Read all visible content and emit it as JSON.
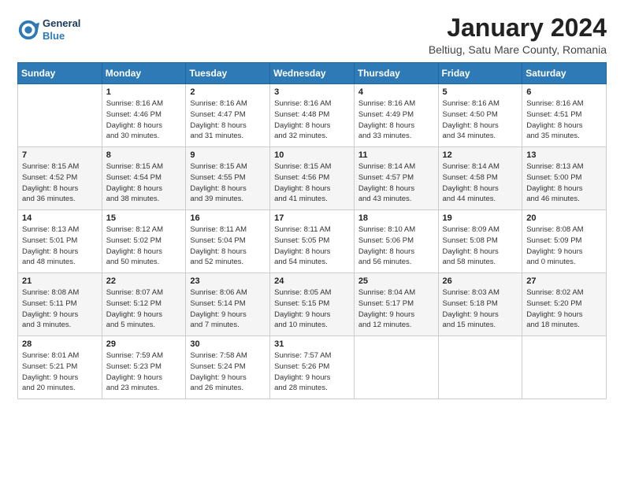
{
  "header": {
    "logo_line1": "General",
    "logo_line2": "Blue",
    "title": "January 2024",
    "subtitle": "Beltiug, Satu Mare County, Romania"
  },
  "days_of_week": [
    "Sunday",
    "Monday",
    "Tuesday",
    "Wednesday",
    "Thursday",
    "Friday",
    "Saturday"
  ],
  "weeks": [
    [
      {
        "num": "",
        "info": ""
      },
      {
        "num": "1",
        "info": "Sunrise: 8:16 AM\nSunset: 4:46 PM\nDaylight: 8 hours\nand 30 minutes."
      },
      {
        "num": "2",
        "info": "Sunrise: 8:16 AM\nSunset: 4:47 PM\nDaylight: 8 hours\nand 31 minutes."
      },
      {
        "num": "3",
        "info": "Sunrise: 8:16 AM\nSunset: 4:48 PM\nDaylight: 8 hours\nand 32 minutes."
      },
      {
        "num": "4",
        "info": "Sunrise: 8:16 AM\nSunset: 4:49 PM\nDaylight: 8 hours\nand 33 minutes."
      },
      {
        "num": "5",
        "info": "Sunrise: 8:16 AM\nSunset: 4:50 PM\nDaylight: 8 hours\nand 34 minutes."
      },
      {
        "num": "6",
        "info": "Sunrise: 8:16 AM\nSunset: 4:51 PM\nDaylight: 8 hours\nand 35 minutes."
      }
    ],
    [
      {
        "num": "7",
        "info": "Sunrise: 8:15 AM\nSunset: 4:52 PM\nDaylight: 8 hours\nand 36 minutes."
      },
      {
        "num": "8",
        "info": "Sunrise: 8:15 AM\nSunset: 4:54 PM\nDaylight: 8 hours\nand 38 minutes."
      },
      {
        "num": "9",
        "info": "Sunrise: 8:15 AM\nSunset: 4:55 PM\nDaylight: 8 hours\nand 39 minutes."
      },
      {
        "num": "10",
        "info": "Sunrise: 8:15 AM\nSunset: 4:56 PM\nDaylight: 8 hours\nand 41 minutes."
      },
      {
        "num": "11",
        "info": "Sunrise: 8:14 AM\nSunset: 4:57 PM\nDaylight: 8 hours\nand 43 minutes."
      },
      {
        "num": "12",
        "info": "Sunrise: 8:14 AM\nSunset: 4:58 PM\nDaylight: 8 hours\nand 44 minutes."
      },
      {
        "num": "13",
        "info": "Sunrise: 8:13 AM\nSunset: 5:00 PM\nDaylight: 8 hours\nand 46 minutes."
      }
    ],
    [
      {
        "num": "14",
        "info": "Sunrise: 8:13 AM\nSunset: 5:01 PM\nDaylight: 8 hours\nand 48 minutes."
      },
      {
        "num": "15",
        "info": "Sunrise: 8:12 AM\nSunset: 5:02 PM\nDaylight: 8 hours\nand 50 minutes."
      },
      {
        "num": "16",
        "info": "Sunrise: 8:11 AM\nSunset: 5:04 PM\nDaylight: 8 hours\nand 52 minutes."
      },
      {
        "num": "17",
        "info": "Sunrise: 8:11 AM\nSunset: 5:05 PM\nDaylight: 8 hours\nand 54 minutes."
      },
      {
        "num": "18",
        "info": "Sunrise: 8:10 AM\nSunset: 5:06 PM\nDaylight: 8 hours\nand 56 minutes."
      },
      {
        "num": "19",
        "info": "Sunrise: 8:09 AM\nSunset: 5:08 PM\nDaylight: 8 hours\nand 58 minutes."
      },
      {
        "num": "20",
        "info": "Sunrise: 8:08 AM\nSunset: 5:09 PM\nDaylight: 9 hours\nand 0 minutes."
      }
    ],
    [
      {
        "num": "21",
        "info": "Sunrise: 8:08 AM\nSunset: 5:11 PM\nDaylight: 9 hours\nand 3 minutes."
      },
      {
        "num": "22",
        "info": "Sunrise: 8:07 AM\nSunset: 5:12 PM\nDaylight: 9 hours\nand 5 minutes."
      },
      {
        "num": "23",
        "info": "Sunrise: 8:06 AM\nSunset: 5:14 PM\nDaylight: 9 hours\nand 7 minutes."
      },
      {
        "num": "24",
        "info": "Sunrise: 8:05 AM\nSunset: 5:15 PM\nDaylight: 9 hours\nand 10 minutes."
      },
      {
        "num": "25",
        "info": "Sunrise: 8:04 AM\nSunset: 5:17 PM\nDaylight: 9 hours\nand 12 minutes."
      },
      {
        "num": "26",
        "info": "Sunrise: 8:03 AM\nSunset: 5:18 PM\nDaylight: 9 hours\nand 15 minutes."
      },
      {
        "num": "27",
        "info": "Sunrise: 8:02 AM\nSunset: 5:20 PM\nDaylight: 9 hours\nand 18 minutes."
      }
    ],
    [
      {
        "num": "28",
        "info": "Sunrise: 8:01 AM\nSunset: 5:21 PM\nDaylight: 9 hours\nand 20 minutes."
      },
      {
        "num": "29",
        "info": "Sunrise: 7:59 AM\nSunset: 5:23 PM\nDaylight: 9 hours\nand 23 minutes."
      },
      {
        "num": "30",
        "info": "Sunrise: 7:58 AM\nSunset: 5:24 PM\nDaylight: 9 hours\nand 26 minutes."
      },
      {
        "num": "31",
        "info": "Sunrise: 7:57 AM\nSunset: 5:26 PM\nDaylight: 9 hours\nand 28 minutes."
      },
      {
        "num": "",
        "info": ""
      },
      {
        "num": "",
        "info": ""
      },
      {
        "num": "",
        "info": ""
      }
    ]
  ]
}
